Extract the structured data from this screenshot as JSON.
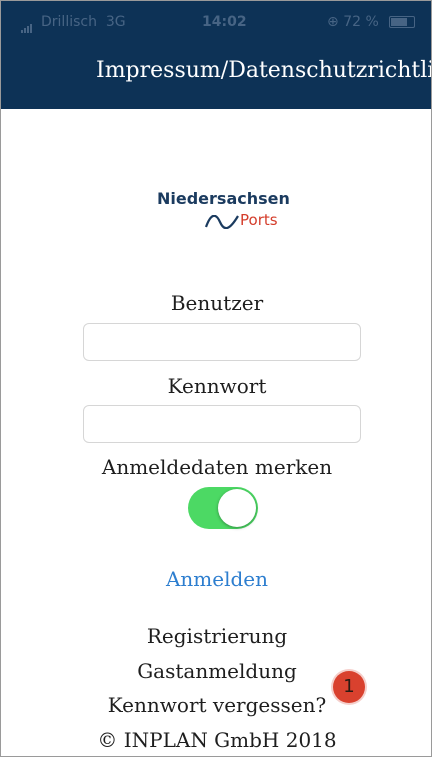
{
  "status_bar": {
    "carrier": "Drillisch",
    "network": "3G",
    "time": "14:02",
    "battery": "72 %"
  },
  "header": {
    "title": "Impressum/Datenschutzrichtlin",
    "background_color": "#0d3256"
  },
  "logo": {
    "line1": "Niedersachsen",
    "line2": "Ports"
  },
  "form": {
    "username_label": "Benutzer",
    "username_value": "",
    "password_label": "Kennwort",
    "password_value": "",
    "remember_label": "Anmeldedaten merken",
    "remember_on": true,
    "toggle_color": "#4cd964"
  },
  "actions": {
    "login": "Anmelden",
    "register": "Registrierung",
    "guest_login": "Gastanmeldung",
    "forgot_password": "Kennwort vergessen?"
  },
  "annotation": {
    "badge": "1"
  },
  "footer": {
    "copyright": "© INPLAN GmbH 2018"
  }
}
